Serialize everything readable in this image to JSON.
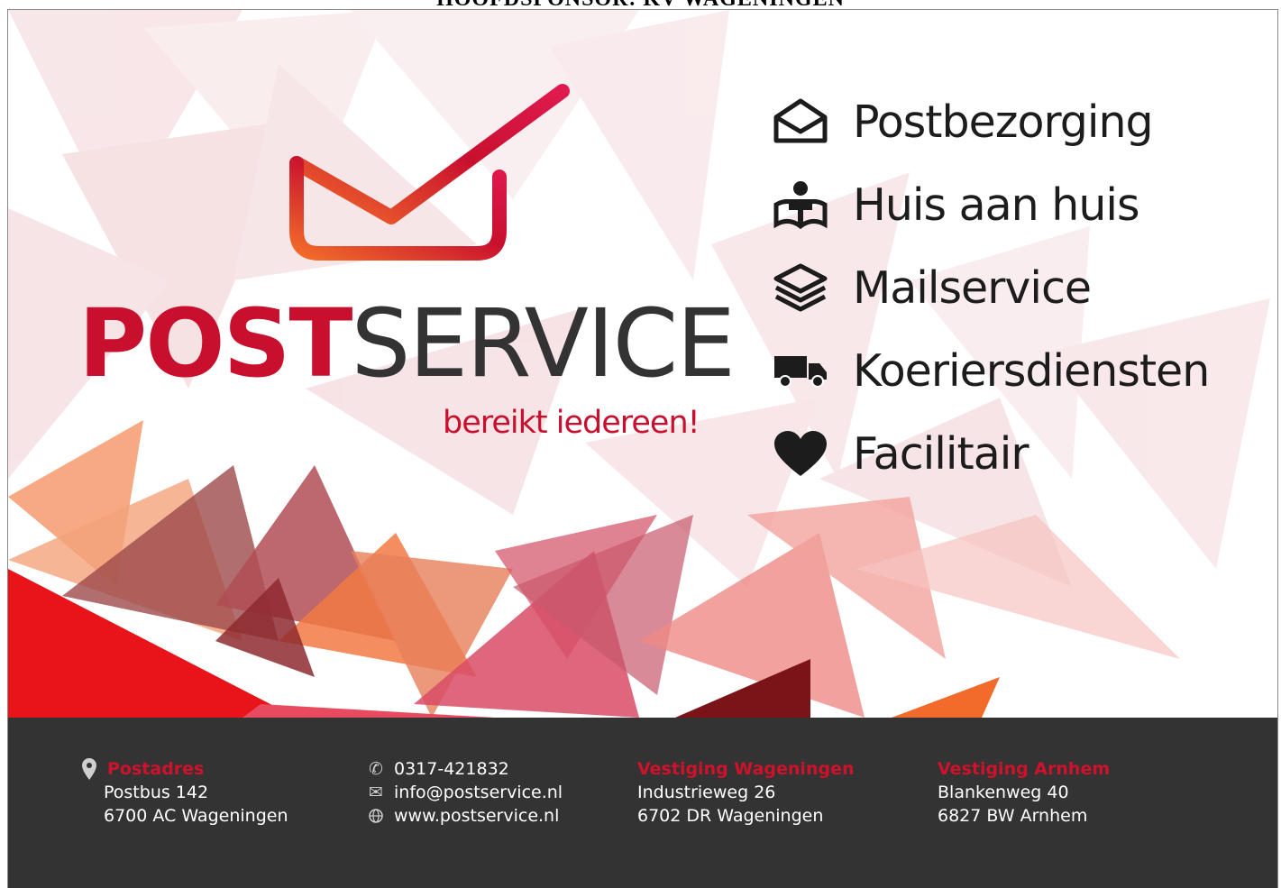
{
  "heading": "HOOFDSPONSOR: KV WAGENINGEN",
  "brand": {
    "part1": "POST",
    "part2": "SERVICE",
    "tagline": "bereikt iedereen!"
  },
  "services": [
    {
      "icon": "envelope-open-icon",
      "label": "Postbezorging"
    },
    {
      "icon": "door-to-door-icon",
      "label": "Huis aan huis"
    },
    {
      "icon": "layers-icon",
      "label": "Mailservice"
    },
    {
      "icon": "truck-icon",
      "label": "Koeriersdiensten"
    },
    {
      "icon": "heart-icon",
      "label": "Facilitair"
    }
  ],
  "footer": {
    "postal": {
      "heading": "Postadres",
      "line1": "Postbus 142",
      "line2": "6700 AC Wageningen"
    },
    "contact": {
      "phone": "0317-421832",
      "email": "info@postservice.nl",
      "web": "www.postservice.nl"
    },
    "wageningen": {
      "heading": "Vestiging Wageningen",
      "line1": "Industrieweg 26",
      "line2": "6702 DR Wageningen"
    },
    "arnhem": {
      "heading": "Vestiging Arnhem",
      "line1": "Blankenweg 40",
      "line2": "6827 BW Arnhem"
    }
  },
  "colors": {
    "brand_red": "#c8102e",
    "dark": "#333333",
    "orange": "#f26b2a"
  }
}
